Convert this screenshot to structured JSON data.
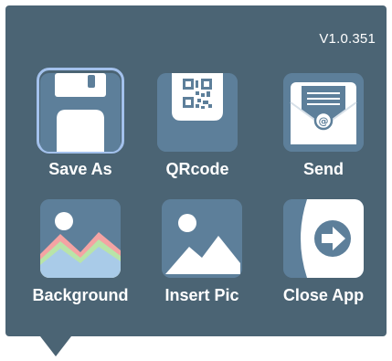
{
  "version": "V1.0.351",
  "items": [
    {
      "label": "Save As",
      "icon": "floppy-disk-icon",
      "selected": true
    },
    {
      "label": "QRcode",
      "icon": "qr-code-icon",
      "selected": false
    },
    {
      "label": "Send",
      "icon": "envelope-icon",
      "selected": false
    },
    {
      "label": "Background",
      "icon": "landscape-chart-icon",
      "selected": false
    },
    {
      "label": "Insert Pic",
      "icon": "picture-icon",
      "selected": false
    },
    {
      "label": "Close App",
      "icon": "exit-arrow-icon",
      "selected": false
    }
  ],
  "colors": {
    "panel": "#4b6474",
    "tile": "#5d7f9a",
    "selection": "#a3c1ec",
    "text": "#ffffff"
  }
}
